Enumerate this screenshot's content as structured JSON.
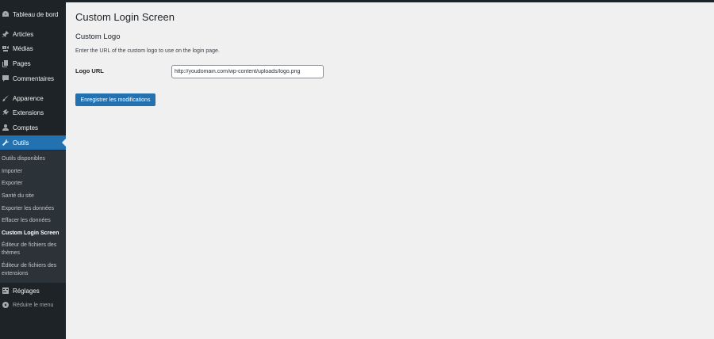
{
  "sidebar": {
    "items": [
      {
        "label": "Tableau de bord",
        "icon": "dashboard-icon"
      },
      {
        "label": "Articles",
        "icon": "pin-icon"
      },
      {
        "label": "Médias",
        "icon": "media-icon"
      },
      {
        "label": "Pages",
        "icon": "pages-icon"
      },
      {
        "label": "Commentaires",
        "icon": "comment-icon"
      },
      {
        "label": "Apparence",
        "icon": "brush-icon"
      },
      {
        "label": "Extensions",
        "icon": "plugin-icon"
      },
      {
        "label": "Comptes",
        "icon": "users-icon"
      },
      {
        "label": "Outils",
        "icon": "wrench-icon"
      },
      {
        "label": "Réglages",
        "icon": "settings-icon"
      },
      {
        "label": "Réduire le menu",
        "icon": "collapse-icon"
      }
    ],
    "submenu": [
      "Outils disponibles",
      "Importer",
      "Exporter",
      "Santé du site",
      "Exporter les données",
      "Effacer les données",
      "Custom Login Screen",
      "Éditeur de fichiers des thèmes",
      "Éditeur de fichiers des extensions"
    ],
    "active_item": "Outils",
    "current_subitem": "Custom Login Screen"
  },
  "main": {
    "page_title": "Custom Login Screen",
    "section_title": "Custom Logo",
    "section_desc": "Enter the URL of the custom logo to use on the login page.",
    "logo_url_label": "Logo URL",
    "logo_url_value": "http://youdomain.com/wp-content/uploads/logo.png",
    "save_label": "Enregistrer les modifications"
  },
  "colors": {
    "sidebar_bg": "#1d2327",
    "submenu_bg": "#2c3338",
    "accent": "#2271b1",
    "page_bg": "#f0f0f1"
  }
}
